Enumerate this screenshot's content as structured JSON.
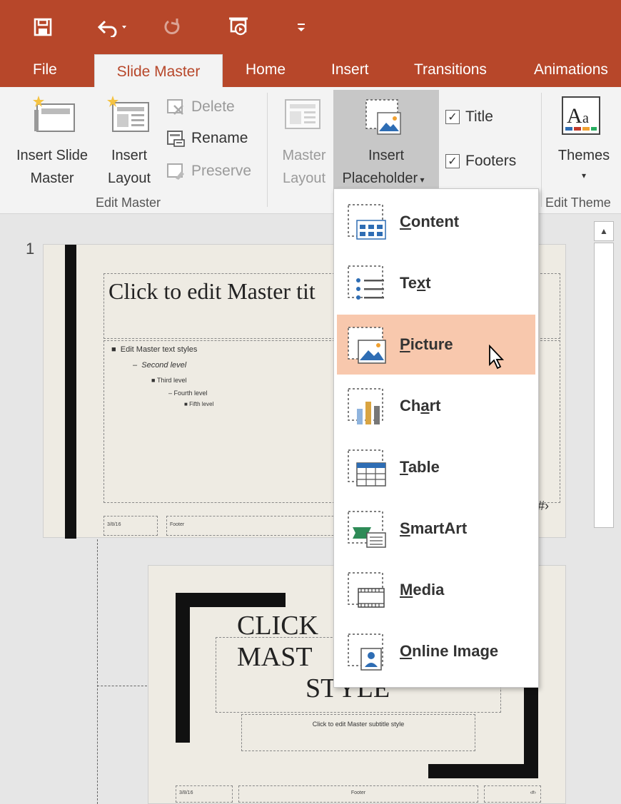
{
  "ribbon_tabs": {
    "file": "File",
    "slide_master": "Slide Master",
    "home": "Home",
    "insert": "Insert",
    "transitions": "Transitions",
    "animations": "Animations"
  },
  "edit_master": {
    "insert_slide_master": [
      "Insert Slide",
      "Master"
    ],
    "insert_layout": [
      "Insert",
      "Layout"
    ],
    "delete": "Delete",
    "rename": "Rename",
    "preserve": "Preserve",
    "group_label": "Edit Master"
  },
  "master_layout": {
    "master_layout": [
      "Master",
      "Layout"
    ],
    "insert_placeholder": [
      "Insert",
      "Placeholder"
    ],
    "title_checkbox": "Title",
    "footers_checkbox": "Footers",
    "title_checked": true,
    "footers_checked": true
  },
  "edit_theme": {
    "themes": "Themes",
    "group_label": "Edit Theme"
  },
  "thumbnails": {
    "slide_number": "1",
    "slide1_title": "Click to edit Master tit",
    "slide1_bullets": [
      "Edit Master text styles",
      "Second level",
      "Third level",
      "Fourth level",
      "Fifth level"
    ],
    "slide1_date": "3/8/16",
    "slide1_footer": "Footer",
    "slide1_page": "‹#›",
    "slide2_title": [
      "CLICK",
      "MAST",
      "STYLE"
    ],
    "slide2_subtitle": "Click to edit Master subtitle style",
    "slide2_date": "3/8/16",
    "slide2_footer": "Footer",
    "slide2_page": "‹#›"
  },
  "placeholder_menu": {
    "items": [
      {
        "label": "Content",
        "accel": "C",
        "rest": "ontent",
        "icon": "content-icon"
      },
      {
        "label": "Text",
        "accel": "x",
        "pre": "Te",
        "rest": "t",
        "icon": "text-icon"
      },
      {
        "label": "Picture",
        "accel": "P",
        "rest": "icture",
        "icon": "picture-icon",
        "hovered": true
      },
      {
        "label": "Chart",
        "accel": "a",
        "pre": "Ch",
        "rest": "rt",
        "icon": "chart-icon"
      },
      {
        "label": "Table",
        "accel": "T",
        "rest": "able",
        "icon": "table-icon"
      },
      {
        "label": "SmartArt",
        "accel": "S",
        "rest": "martArt",
        "icon": "smartart-icon"
      },
      {
        "label": "Media",
        "accel": "M",
        "rest": "edia",
        "icon": "media-icon"
      },
      {
        "label": "Online Image",
        "accel": "O",
        "rest": "nline Image",
        "icon": "online-image-icon"
      }
    ]
  },
  "colors": {
    "accent": "#b7472a",
    "hover": "#f8c8ad",
    "slide_bg": "#eeebe3"
  }
}
